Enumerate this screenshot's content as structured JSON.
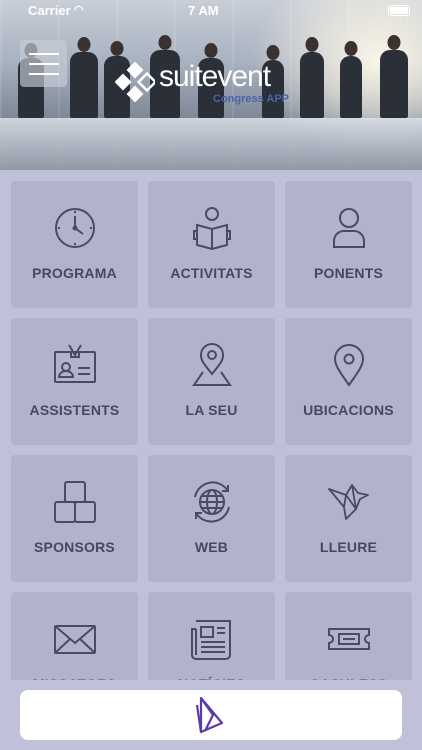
{
  "status_bar": {
    "carrier": "Carrier",
    "time": "7 AM"
  },
  "header": {
    "logo_text": "suitevent",
    "logo_subtitle": "Congress APP"
  },
  "tiles": [
    {
      "label": "PROGRAMA",
      "icon": "clock-icon"
    },
    {
      "label": "ACTIVITATS",
      "icon": "person-reading-icon"
    },
    {
      "label": "PONENTS",
      "icon": "user-icon"
    },
    {
      "label": "ASSISTENTS",
      "icon": "id-badge-icon"
    },
    {
      "label": "LA SEU",
      "icon": "map-pin-icon"
    },
    {
      "label": "UBICACIONS",
      "icon": "location-pin-icon"
    },
    {
      "label": "SPONSORS",
      "icon": "boxes-icon"
    },
    {
      "label": "WEB",
      "icon": "globe-refresh-icon"
    },
    {
      "label": "LLEURE",
      "icon": "origami-bird-icon"
    },
    {
      "label": "MISSATGES",
      "icon": "envelope-icon"
    },
    {
      "label": "NOTÍCIES",
      "icon": "newspaper-icon"
    },
    {
      "label": "CASHLESS",
      "icon": "ticket-icon"
    }
  ],
  "colors": {
    "background": "#bfc1d8",
    "tile": "#b1b3cd",
    "icon_stroke": "#4a4a60",
    "label": "#47475e",
    "logo_accent": "#4b63a8",
    "footer_logo": "#5a3aa8"
  }
}
